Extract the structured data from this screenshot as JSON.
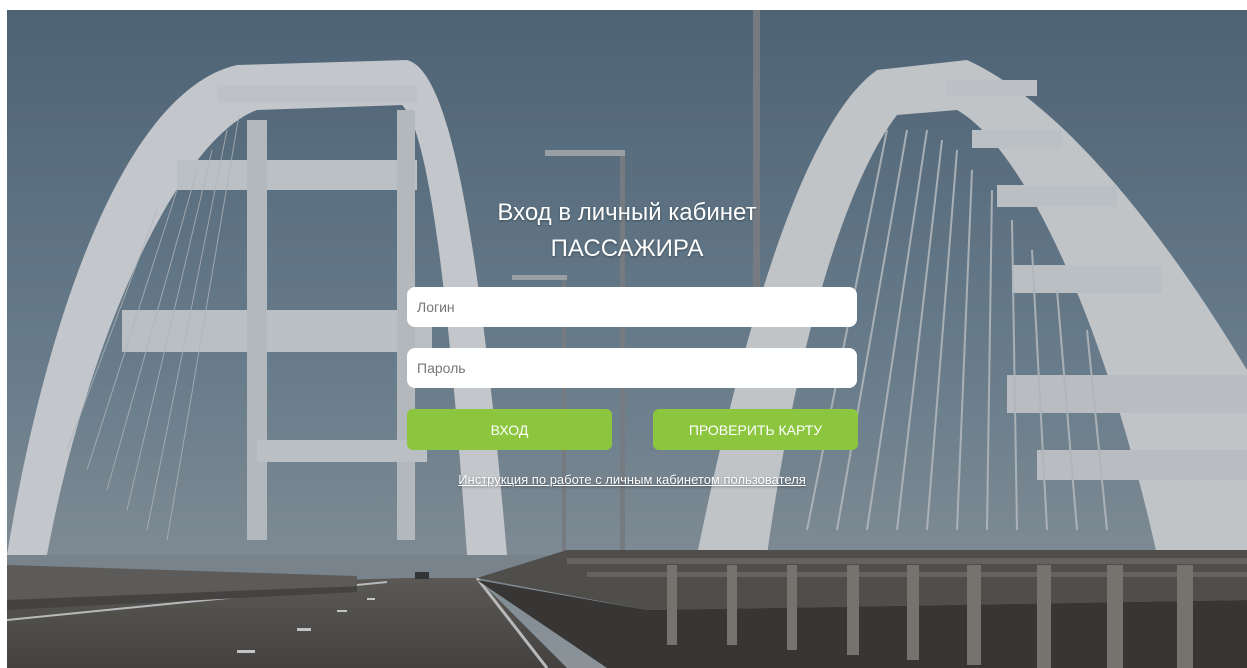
{
  "page": {
    "title_line1": "Вход в личный кабинет",
    "title_line2": "ПАССАЖИРА"
  },
  "form": {
    "login_placeholder": "Логин",
    "login_value": "",
    "password_placeholder": "Пароль",
    "password_value": "",
    "login_button_label": "ВХОД",
    "check_card_button_label": "ПРОВЕРИТЬ КАРТУ"
  },
  "links": {
    "manual_label": "Инструкция по работе с личным кабинетом пользователя"
  },
  "colors": {
    "accent_button": "#8cc63f",
    "input_bg": "#ffffff",
    "text_light": "#ffffff"
  },
  "background": {
    "scene": "bridge-arches-photo"
  }
}
